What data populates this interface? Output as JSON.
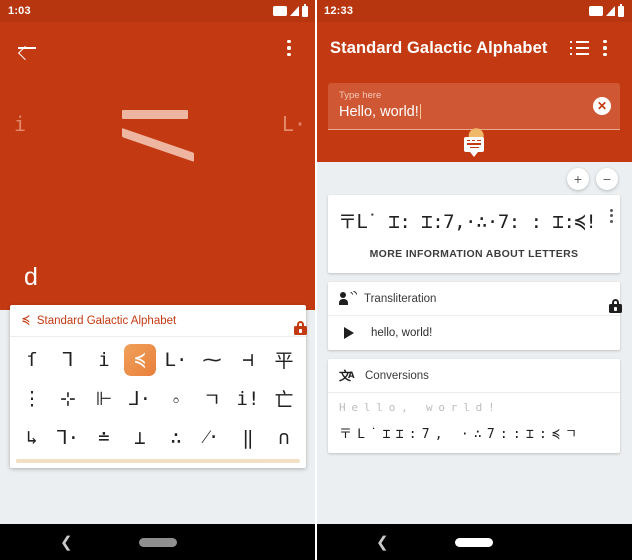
{
  "left_screen": {
    "status_bar": {
      "time": "1:03",
      "icons": [
        "wifi-icon",
        "signal-icon",
        "battery-icon"
      ]
    },
    "app_bar": {
      "back_icon": "back-arrow-icon",
      "overflow_icon": "overflow-menu-icon"
    },
    "hero": {
      "selected_glyph": "big-galactic-glyph-d",
      "prev_glyph": "i",
      "next_glyph": "L·",
      "latin_letter": "d"
    },
    "keyboard": {
      "header_glyph": "≼",
      "header_label": "Standard Galactic Alphabet",
      "lock_icon": "lock-icon",
      "rows": [
        [
          "ſ",
          "⅂",
          "i",
          "≼",
          "L·",
          "⁓",
          "⊣",
          "平"
        ],
        [
          "⋮",
          "⊹",
          "⊩",
          "⅃·",
          "𝇈",
          "ㄱ",
          "i!",
          "亡"
        ],
        [
          "↳",
          "⅂·",
          "≐",
          "⊥",
          "∴",
          "⁄·",
          "‖",
          "∩"
        ]
      ],
      "selected_key": {
        "row": 0,
        "index": 3,
        "glyph": "≼"
      }
    }
  },
  "right_screen": {
    "status_bar": {
      "time": "12:33",
      "icons": [
        "wifi-icon",
        "signal-icon",
        "battery-icon"
      ]
    },
    "app_bar": {
      "title": "Standard Galactic Alphabet",
      "list_icon": "list-view-icon",
      "overflow_icon": "overflow-menu-icon"
    },
    "input": {
      "label": "Type here",
      "value": "Hello, world!",
      "clear_icon": "clear-circle-icon",
      "keyboard_toggle_icon": "keyboard-icon",
      "drag_handle": "text-selection-handle"
    },
    "zoom_controls": {
      "increase": "+",
      "decrease": "−"
    },
    "display_card": {
      "glyph_text": "〒𝖫˙ ⌶: ⌶:7,·∴·7: : ⌶:≼!",
      "overflow_icon": "overflow-menu-icon",
      "more_info_label": "MORE INFORMATION ABOUT LETTERS"
    },
    "transliteration_card": {
      "icon": "speak-person-icon",
      "title": "Transliteration",
      "lock_icon": "lock-icon",
      "play_icon": "play-icon",
      "text": "hello, world!"
    },
    "conversions_card": {
      "icon": "translate-icon",
      "title": "Conversions",
      "latin_letters": [
        "H",
        "e",
        "l",
        "l",
        "o",
        ",",
        " ",
        "w",
        "o",
        "r",
        "l",
        "d",
        "!"
      ],
      "glyph_letters": [
        "〒",
        "𝖫˙",
        "⌶",
        "⌶:",
        "7",
        ",",
        " ",
        "·",
        "∴",
        "7",
        "::",
        "⌶:",
        "≼",
        "ㄱ"
      ]
    }
  },
  "navigation": {
    "left": {
      "back_icon": "back-chevron-icon",
      "home_pill": "home-pill",
      "pill_color": "#8f8f8f"
    },
    "right": {
      "back_icon": "back-chevron-icon",
      "home_pill": "home-pill",
      "pill_color": "#ffffff"
    }
  },
  "colors": {
    "primary": "#c33a12",
    "status_bar": "#b8360f",
    "background": "#eceff1",
    "accent": "#e8803c"
  }
}
